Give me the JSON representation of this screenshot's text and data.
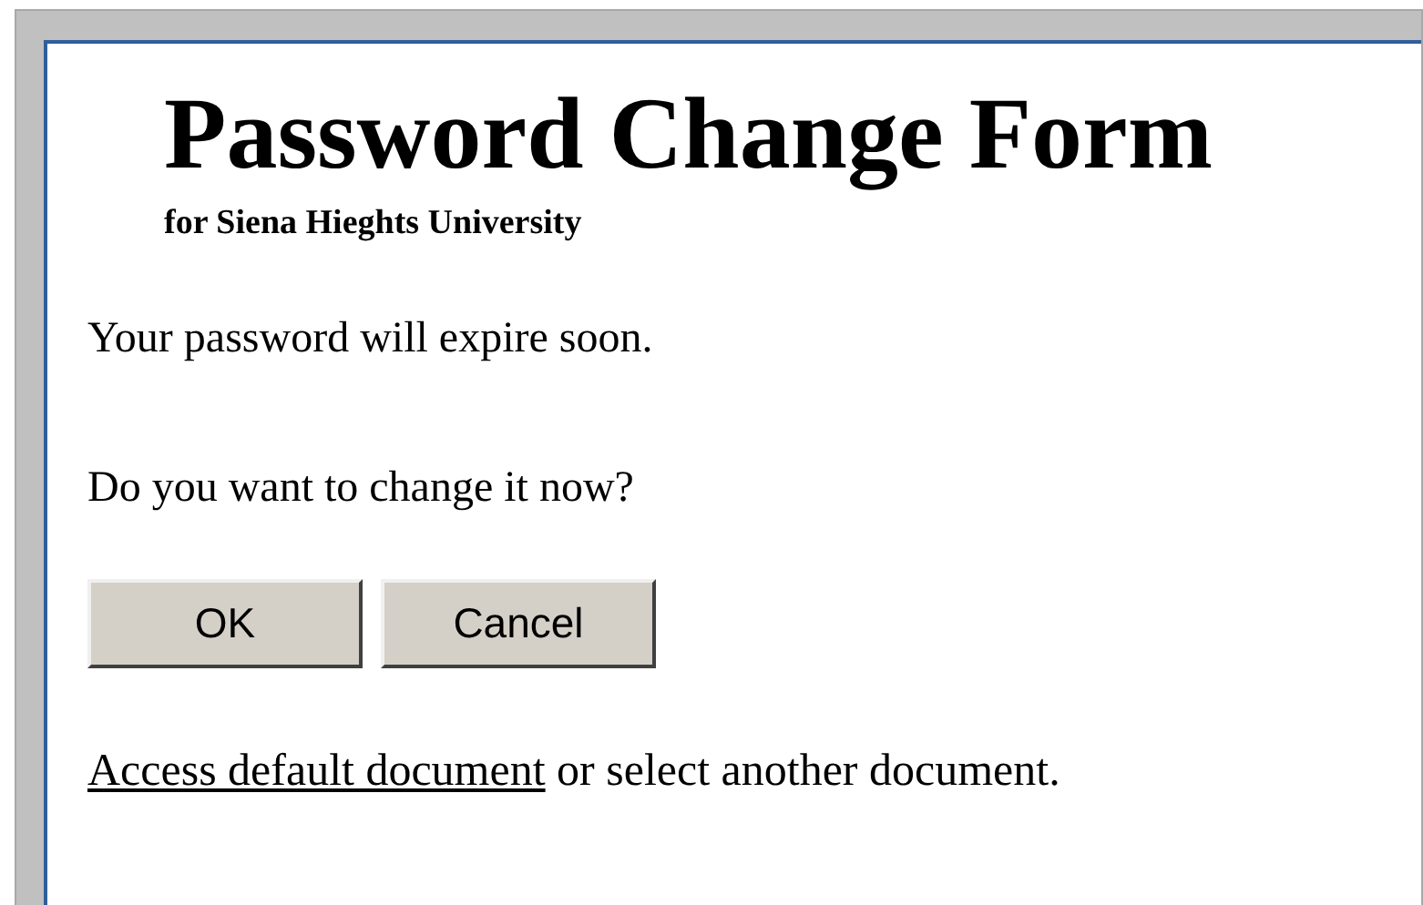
{
  "title": "Password Change Form",
  "subtitle": "for Siena Hieghts University",
  "messages": [
    "Your password will expire soon.",
    "Do you want to change it now?"
  ],
  "buttons": [
    "OK",
    "Cancel"
  ],
  "footer": {
    "link": "Access default document",
    "text": " or select another document."
  }
}
